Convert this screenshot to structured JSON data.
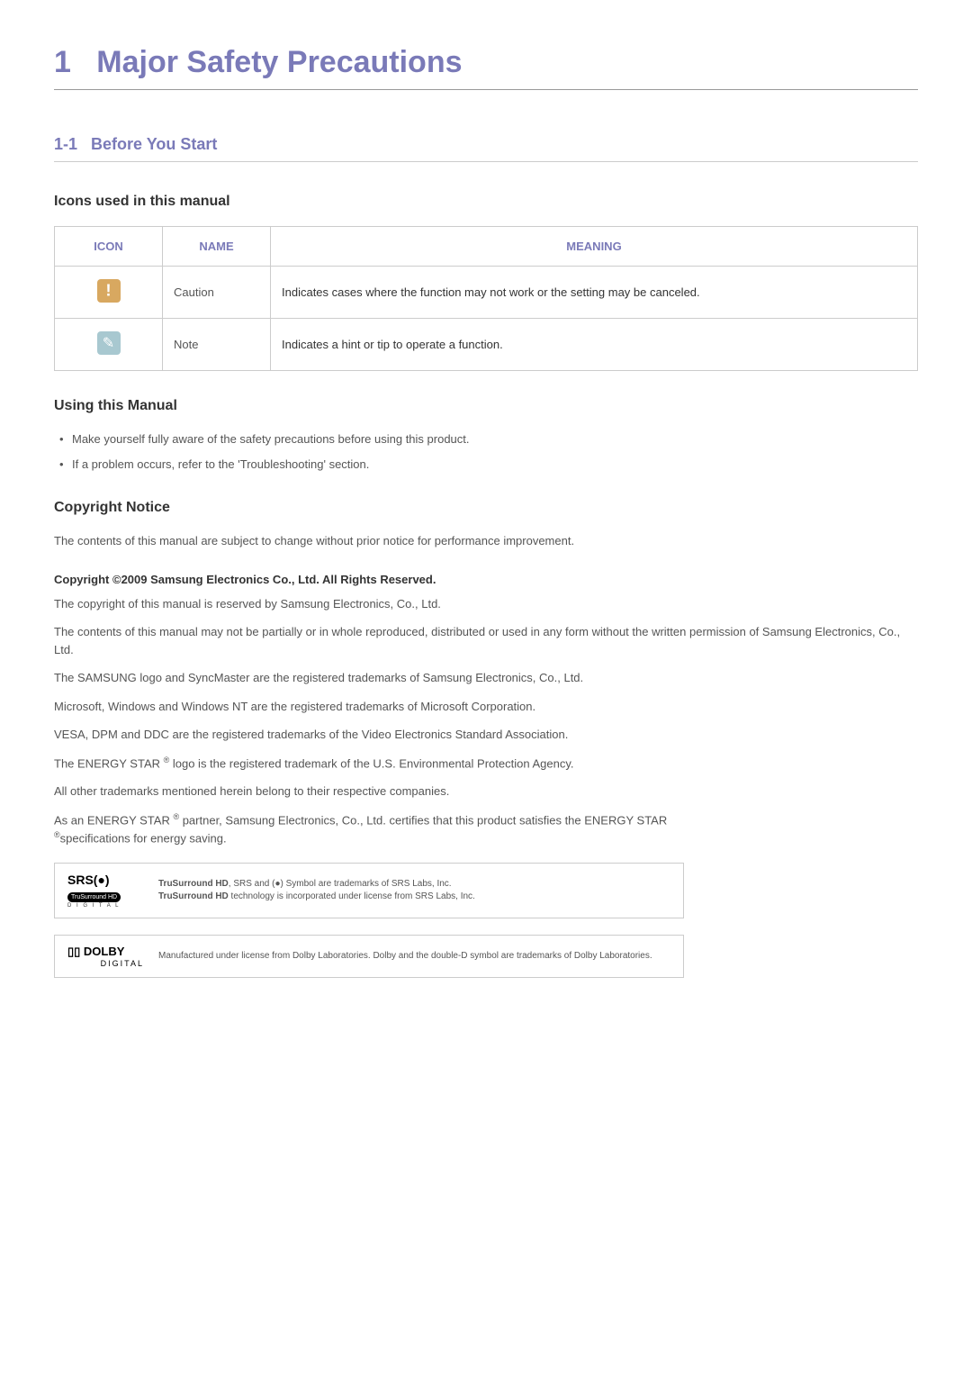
{
  "chapter": {
    "number": "1",
    "title": "Major Safety Precautions"
  },
  "section": {
    "number": "1-1",
    "title": "Before You Start"
  },
  "icons_section": {
    "title": "Icons used in this manual",
    "headers": {
      "icon": "ICON",
      "name": "NAME",
      "meaning": "MEANING"
    },
    "rows": [
      {
        "name": "Caution",
        "meaning": "Indicates cases where the function may not work or the setting may be canceled."
      },
      {
        "name": "Note",
        "meaning": "Indicates a hint or tip to operate a function."
      }
    ]
  },
  "using_manual": {
    "title": "Using this Manual",
    "items": [
      "Make yourself fully aware of the safety precautions before using this product.",
      "If a problem occurs, refer to the 'Troubleshooting' section."
    ]
  },
  "copyright": {
    "title": "Copyright Notice",
    "intro": "The contents of this manual are subject to change without prior notice for performance improvement.",
    "strong": "Copyright ©2009 Samsung Electronics Co., Ltd. All Rights Reserved.",
    "paragraphs": [
      "The copyright of this manual is reserved by Samsung Electronics, Co., Ltd.",
      "The contents of this manual may not be partially or in whole reproduced, distributed or used in any form without the written permission of Samsung Electronics, Co., Ltd.",
      "The SAMSUNG logo and SyncMaster are the registered trademarks of Samsung Electronics, Co., Ltd.",
      "Microsoft, Windows and Windows NT are the registered trademarks of Microsoft Corporation.",
      "VESA, DPM and DDC are the registered trademarks of the Video Electronics Standard Association."
    ],
    "energy_star_1_prefix": "The ENERGY STAR ",
    "energy_star_1_suffix": " logo is the registered trademark of the U.S. Environmental Protection Agency.",
    "other_trademarks": "All other trademarks mentioned herein belong to their respective companies.",
    "energy_star_2_prefix": "As an ENERGY STAR ",
    "energy_star_2_mid": " partner, Samsung Electronics, Co., Ltd. certifies that this product satisfies the ENERGY STAR ",
    "energy_star_2_suffix": "specifications for energy saving.",
    "reg_mark": "®"
  },
  "srs": {
    "logo_main": "SRS(●)",
    "logo_badge": "TruSurround HD",
    "logo_sub": "D I G I T A L",
    "text_line1_bold": "TruSurround HD",
    "text_line1_rest": ", SRS and (●) Symbol are trademarks of SRS Labs, Inc.",
    "text_line2_bold": "TruSurround HD",
    "text_line2_rest": " technology is incorporated under license from SRS Labs, Inc."
  },
  "dolby": {
    "logo_main": "▯▯ DOLBY",
    "logo_sub": "DIGITAL",
    "text": "Manufactured under license from Dolby Laboratories. Dolby and the double-D symbol are trademarks of Dolby Laboratories."
  }
}
